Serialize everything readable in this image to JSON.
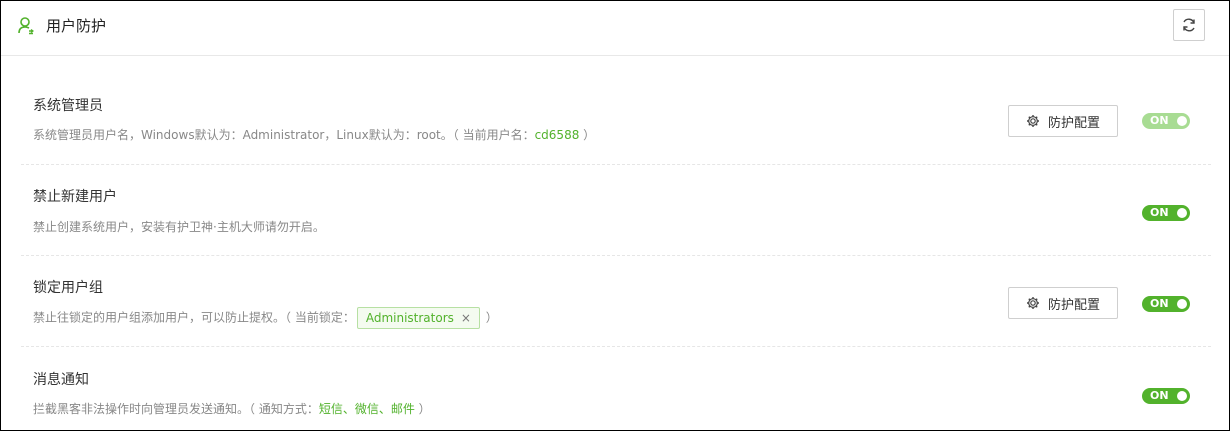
{
  "header": {
    "title": "用户防护",
    "icon": "user-shield-icon",
    "refresh_icon": "refresh-icon"
  },
  "rows": [
    {
      "title": "系统管理员",
      "desc_prefix": "系统管理员用户名，Windows默认为：Administrator，Linux默认为：root。（ 当前用户名：",
      "desc_highlight": "cd6588",
      "desc_suffix": " ）",
      "config_label": "防护配置",
      "toggle_label": "ON",
      "toggle_state": "on-disabled"
    },
    {
      "title": "禁止新建用户",
      "desc": "禁止创建系统用户，安装有护卫神·主机大师请勿开启。",
      "toggle_label": "ON",
      "toggle_state": "on"
    },
    {
      "title": "锁定用户组",
      "desc_prefix": "禁止往锁定的用户组添加用户，可以防止提权。（ 当前锁定：",
      "tag": "Administrators",
      "tag_close": "×",
      "desc_suffix": " ）",
      "config_label": "防护配置",
      "toggle_label": "ON",
      "toggle_state": "on"
    },
    {
      "title": "消息通知",
      "desc_prefix": "拦截黑客非法操作时向管理员发送通知。（ 通知方式：",
      "desc_highlight": "短信、微信、邮件",
      "desc_suffix": " ）",
      "toggle_label": "ON",
      "toggle_state": "on"
    }
  ],
  "colors": {
    "accent": "#52b22c",
    "accent_dim": "#a8dc93",
    "border": "#cfcfcf"
  }
}
